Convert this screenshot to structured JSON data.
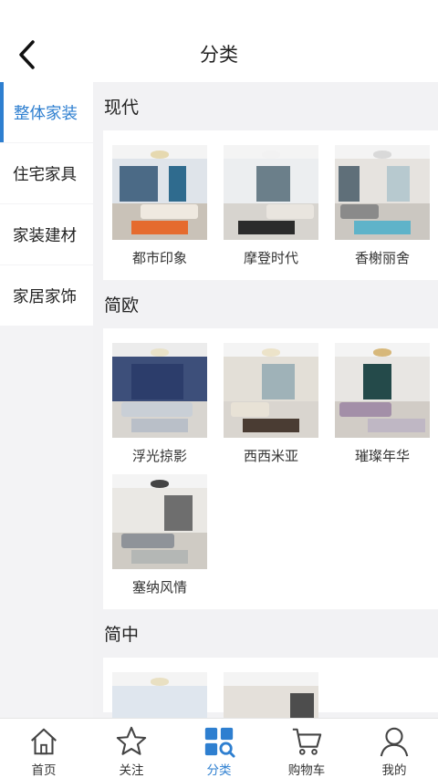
{
  "header": {
    "title": "分类",
    "back_icon": "chevron-left-icon"
  },
  "sidebar": {
    "items": [
      {
        "label": "整体家装",
        "active": true
      },
      {
        "label": "住宅家具",
        "active": false
      },
      {
        "label": "家装建材",
        "active": false
      },
      {
        "label": "家居家饰",
        "active": false
      }
    ]
  },
  "sections": [
    {
      "title": "现代",
      "items": [
        {
          "label": "都市印象"
        },
        {
          "label": "摩登时代"
        },
        {
          "label": "香榭丽舍"
        }
      ]
    },
    {
      "title": "简欧",
      "items": [
        {
          "label": "浮光掠影"
        },
        {
          "label": "西西米亚"
        },
        {
          "label": "璀璨年华"
        },
        {
          "label": "塞纳风情"
        }
      ]
    },
    {
      "title": "简中",
      "items": []
    }
  ],
  "tabbar": {
    "tabs": [
      {
        "label": "首页",
        "icon": "home-icon",
        "active": false
      },
      {
        "label": "关注",
        "icon": "star-icon",
        "active": false
      },
      {
        "label": "分类",
        "icon": "category-grid-icon",
        "active": true
      },
      {
        "label": "购物车",
        "icon": "cart-icon",
        "active": false
      },
      {
        "label": "我的",
        "icon": "user-icon",
        "active": false
      }
    ]
  },
  "colors": {
    "accent": "#2e7fd0",
    "background": "#f2f2f4"
  }
}
